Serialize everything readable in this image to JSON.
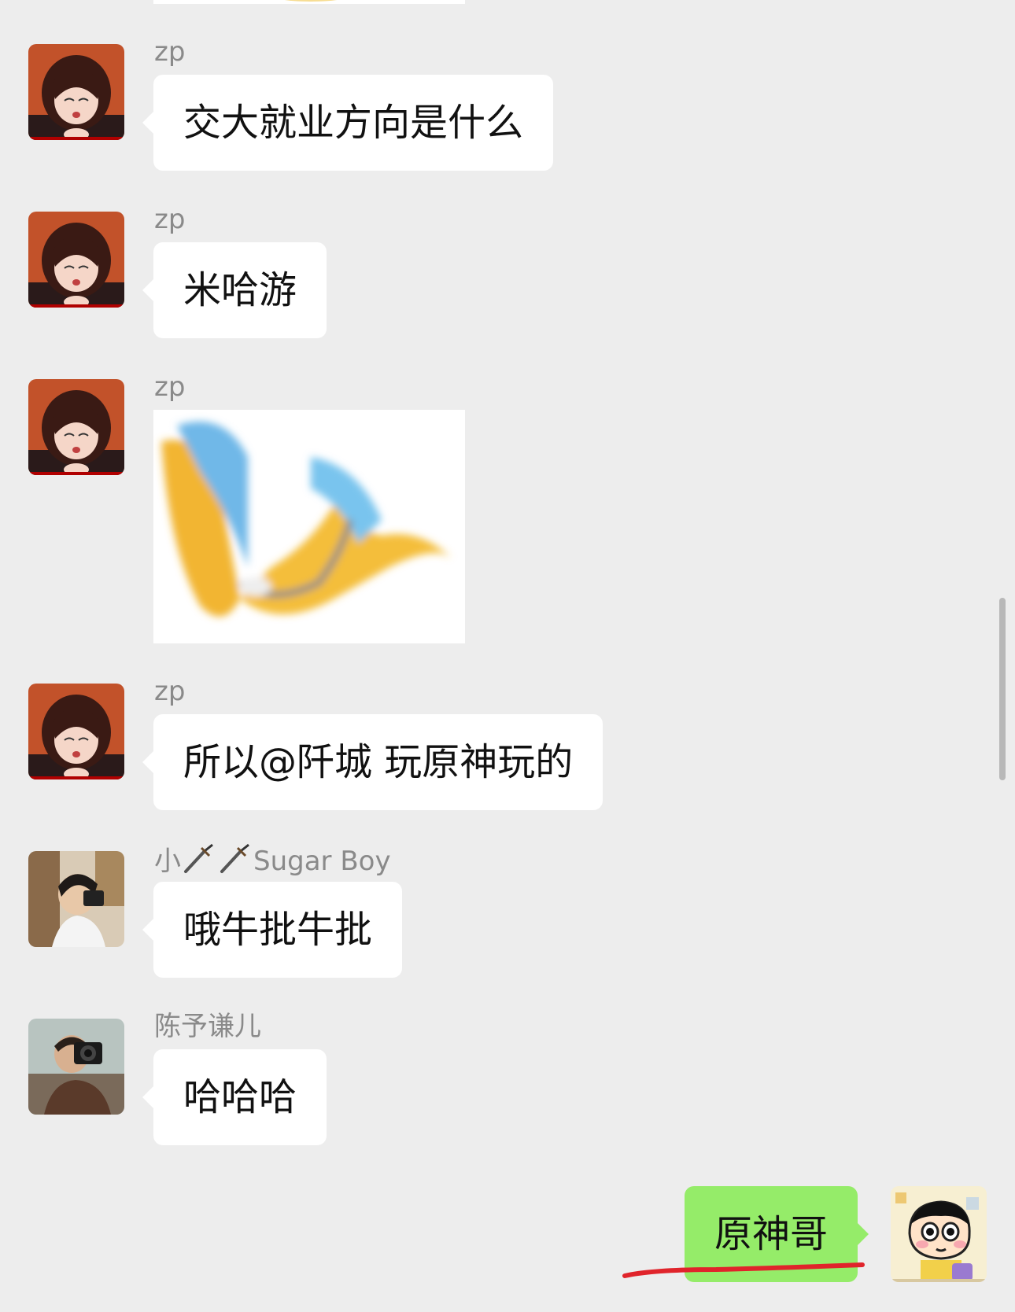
{
  "chat": {
    "messages": [
      {
        "sender": "zp",
        "text": "交大就业方向是什么"
      },
      {
        "sender": "zp",
        "text": "米哈游"
      },
      {
        "sender": "zp",
        "sticker": "blurry-yellow-duck-sticker"
      },
      {
        "sender": "zp",
        "text": "所以@阡城 玩原神玩的"
      },
      {
        "sender_prefix": "小",
        "sender_suffix": "Sugar Boy",
        "sender_icons": [
          "dagger-icon",
          "dagger-icon"
        ],
        "text": "哦牛批牛批"
      },
      {
        "sender": "陈予谦儿",
        "text": "哈哈哈"
      },
      {
        "self": true,
        "text": "原神哥"
      }
    ]
  },
  "colors": {
    "background": "#ededed",
    "incoming_bubble": "#ffffff",
    "outgoing_bubble": "#95ec69",
    "sender_name": "#8a8a8a",
    "annotation_underline": "#e0242b"
  }
}
